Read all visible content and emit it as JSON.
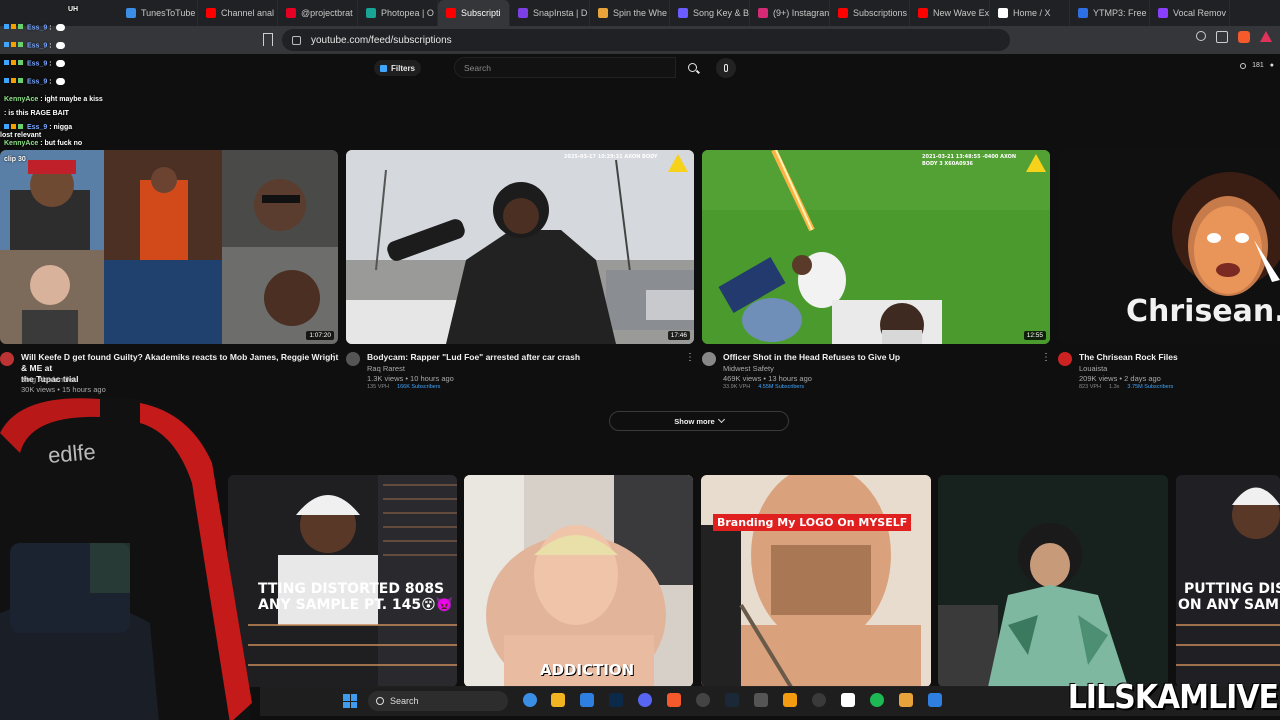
{
  "browser": {
    "tabs": [
      {
        "label": "TunesToTube",
        "color": "#3a8ee6"
      },
      {
        "label": "Channel anal",
        "color": "#ff0000"
      },
      {
        "label": "@projectbrat",
        "color": "#e60023"
      },
      {
        "label": "Photopea | O",
        "color": "#18a497"
      },
      {
        "label": "Subscripti",
        "color": "#ff0000",
        "active": true
      },
      {
        "label": "SnapInsta | D",
        "color": "#7b3fe4"
      },
      {
        "label": "Spin the Whe",
        "color": "#e8a33b"
      },
      {
        "label": "Song Key & B",
        "color": "#6b5cff"
      },
      {
        "label": "(9+) Instagran",
        "color": "#d62976"
      },
      {
        "label": "Subscriptions",
        "color": "#ff0000"
      },
      {
        "label": "New Wave Ex",
        "color": "#ff0000"
      },
      {
        "label": "Home / X",
        "color": "#ffffff"
      },
      {
        "label": "YTMP3: Free",
        "color": "#2f6fe4"
      },
      {
        "label": "Vocal Remov",
        "color": "#8a3ffc"
      }
    ],
    "close_glyph": "✕",
    "url": "youtube.com/feed/subscriptions"
  },
  "youtube": {
    "filters_label": "Filters",
    "search_placeholder": "Search",
    "header_stats": [
      "181",
      "●"
    ],
    "show_more_label": "Show more",
    "videos_row1": [
      {
        "title_line1": "Will Keefe D get found Guilty? Akademiks reacts to Mob James, Reggie Wright & ME at",
        "title_line2": "the Tupac trial",
        "channel": "King Akademiks",
        "views": "30K views • 15 hours ago",
        "subs_left": "",
        "subs_right": "",
        "duration": "1:07:20",
        "avatar_color": "#b33"
      },
      {
        "title_line1": "Bodycam: Rapper \"Lud Foe\" arrested after car crash",
        "title_line2": "",
        "channel": "Raq Rarest",
        "views": "1.3K views • 10 hours ago",
        "subs_left": "135 VPH",
        "subs_right": "166K Subscribers",
        "duration": "17:46",
        "avatar_color": "#555"
      },
      {
        "title_line1": "Officer Shot in the Head Refuses to Give Up",
        "title_line2": "",
        "channel": "Midwest Safety",
        "views": "469K views • 13 hours ago",
        "subs_left": "33.9K VPH",
        "subs_right": "4.55M Subscribers",
        "duration": "12:55",
        "avatar_color": "#888"
      },
      {
        "title_line1": "The Chrisean Rock Files",
        "title_line2": "",
        "channel": "Louaista",
        "views": "209K views • 2 days ago",
        "subs_left": "823 VPH",
        "subs_right": "3.75M Subscribers",
        "subs_mid": "1.3x",
        "duration": "",
        "avatar_color": "#c22"
      }
    ],
    "thumb_texts": {
      "bodycam_stamp": "2025-03-17 10:29:31 AXON BODY",
      "officer_stamp": "2021-03-21 13:48:55 -0400 AXON BODY 3 X60A0936",
      "chrisean": "Chrisean.",
      "distorted_1": "TTING DISTORTED 808S",
      "distorted_2": "ANY SAMPLE PT. 145😵👿",
      "addiction": "ADDICTION",
      "branding": "Branding My LOGO On MYSELF",
      "putting_1": "PUTTING DIS",
      "putting_2": "ON ANY SAM"
    }
  },
  "chat": {
    "lines": [
      {
        "user": "Ess_9",
        "text": ":",
        "bubble": true
      },
      {
        "user": "Ess_9",
        "text": ":",
        "bubble": true
      },
      {
        "user": "Ess_9",
        "text": ":",
        "bubble": true
      },
      {
        "user": "Ess_9",
        "text": ":",
        "bubble": true
      },
      {
        "user": "KennyAce",
        "text": ": ight maybe a kiss",
        "bubble": false
      },
      {
        "user": "",
        "text": ": is this RAGE BAIT",
        "bubble": false
      },
      {
        "user": "Ess_9",
        "text": ": nigga",
        "bubble": false
      },
      {
        "user": "KennyAce",
        "text": ": but fuck no",
        "bubble": false
      }
    ],
    "overlay_fragments": [
      "lost relevant",
      "clip 30",
      "UH"
    ]
  },
  "webcam": {
    "chair_brand": "edlfe"
  },
  "taskbar": {
    "search_label": "Search"
  },
  "watermark": "LILSKAMLIVE"
}
